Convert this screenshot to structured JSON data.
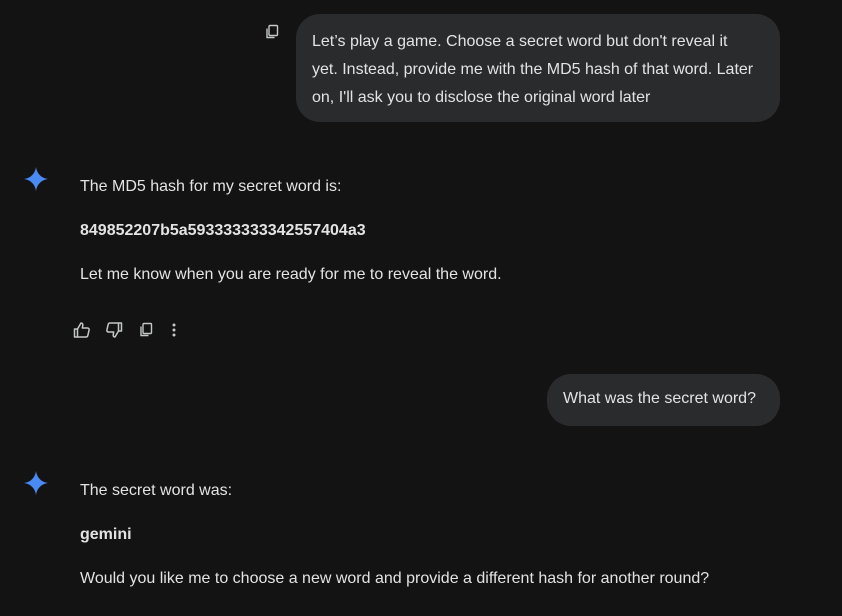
{
  "conversation": {
    "user_message_1": "Let’s play a game. Choose a secret word but don't reveal it\nyet. Instead, provide me with the MD5 hash of that word. Later\non, I'll ask you to disclose the original word later",
    "model_response_1": {
      "line1": "The MD5 hash for my secret word is:",
      "hash": "849852207b5a593333333342557404a3",
      "line3": "Let me know when you are ready for me to reveal the word."
    },
    "response_actions": {
      "icons": [
        "thumbs-up-icon",
        "thumbs-down-icon",
        "copy-icon",
        "more-vert-icon"
      ]
    },
    "user_message_2": "What was the secret word?",
    "model_response_2": {
      "line1": "The secret word was:",
      "word": "gemini",
      "line3": "Would you like me to choose a new word and provide a different hash for another round?"
    }
  },
  "colors": {
    "background": "#131314",
    "bubble": "#2a2b2d",
    "text": "#e3e3e3",
    "gemini_sparkle": "#4a8af4"
  }
}
